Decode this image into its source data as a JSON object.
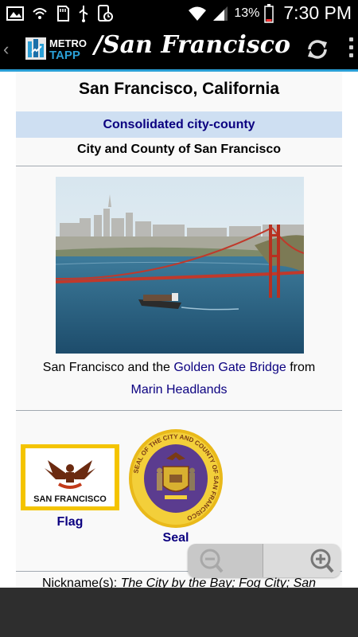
{
  "status_bar": {
    "battery_percent": "13%",
    "time": "7:30 PM"
  },
  "action_bar": {
    "app_logo_line1": "METRO",
    "app_logo_line2": "TAPP",
    "title": "/San Francisco"
  },
  "infobox": {
    "title": "San Francisco, California",
    "type": "Consolidated city-county",
    "official_name": "City and County of San Francisco",
    "image_caption_prefix": "San Francisco and the ",
    "image_caption_link1": "Golden Gate Bridge",
    "image_caption_middle": " from",
    "image_caption_link2": "Marin Headlands",
    "flag_text": "SAN FRANCISCO",
    "flag_label": "Flag",
    "seal_label": "Seal",
    "seal_ring_text": "SEAL OF THE CITY AND COUNTY OF SAN FRANCISCO",
    "nickname_label": "Nickname(s): ",
    "nickname_value": "The City by the Bay; Fog City; San"
  },
  "colors": {
    "accent": "#2a9fd6",
    "link": "#0b0080",
    "type_band": "#cedff2",
    "flag_gold": "#f4c400"
  }
}
